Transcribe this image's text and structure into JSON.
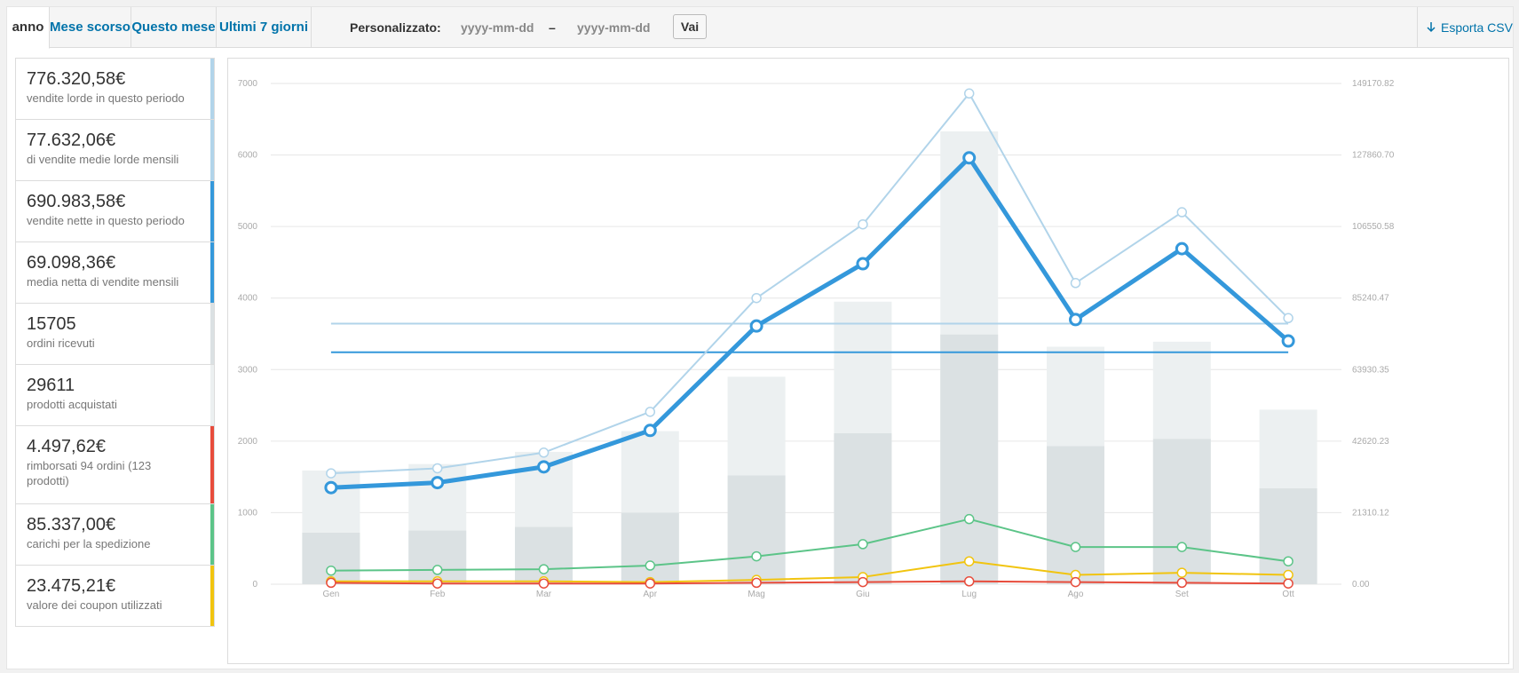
{
  "tabs": [
    {
      "label": "anno",
      "active": true
    },
    {
      "label": "Mese scorso"
    },
    {
      "label": "Questo mese"
    },
    {
      "label": "Ultimi 7 giorni"
    }
  ],
  "custom": {
    "label": "Personalizzato:",
    "start_placeholder": "yyyy-mm-dd",
    "separator": "–",
    "end_placeholder": "yyyy-mm-dd",
    "go_label": "Vai"
  },
  "export": {
    "icon": "arrow-down-icon",
    "label": "Esporta CSV"
  },
  "legend": [
    {
      "value": "776.320,58€",
      "desc": "vendite lorde in questo periodo",
      "color": "#b1d4ea"
    },
    {
      "value": "77.632,06€",
      "desc": "di vendite medie lorde mensili",
      "color": "#b1d4ea"
    },
    {
      "value": "690.983,58€",
      "desc": "vendite nette in questo periodo",
      "color": "#3498db"
    },
    {
      "value": "69.098,36€",
      "desc": "media netta di vendite mensili",
      "color": "#3498db"
    },
    {
      "value": "15705",
      "desc": "ordini ricevuti",
      "color": "#dbe1e3"
    },
    {
      "value": "29611",
      "desc": "prodotti acquistati",
      "color": "#ecf0f1"
    },
    {
      "value": "4.497,62€",
      "desc": "rimborsati 94 ordini (123 prodotti)",
      "color": "#e74c3c"
    },
    {
      "value": "85.337,00€",
      "desc": "carichi per la spedizione",
      "color": "#5cc488"
    },
    {
      "value": "23.475,21€",
      "desc": "valore dei coupon utilizzati",
      "color": "#f1c40f"
    }
  ],
  "chart_data": {
    "type": "bar",
    "categories": [
      "Gen",
      "Feb",
      "Mar",
      "Apr",
      "Mag",
      "Giu",
      "Lug",
      "Ago",
      "Set",
      "Ott"
    ],
    "left_axis": {
      "ylim": [
        0,
        7000
      ],
      "ticks": [
        "0",
        "1000",
        "2000",
        "3000",
        "4000",
        "5000",
        "6000",
        "7000"
      ]
    },
    "right_axis": {
      "ylim": [
        0,
        149170.82
      ],
      "ticks": [
        "0.00",
        "21310.12",
        "42620.23",
        "63930.35",
        "85240.47",
        "106550.58",
        "127860.70",
        "149170.82"
      ]
    },
    "grid": true,
    "series": [
      {
        "name": "prodotti acquistati",
        "kind": "bar",
        "axis": "left",
        "color": "#ecf0f1",
        "values": [
          1590,
          1680,
          1850,
          2140,
          2900,
          3950,
          6330,
          3320,
          3390,
          2440
        ]
      },
      {
        "name": "ordini ricevuti",
        "kind": "bar",
        "axis": "left",
        "color": "#dbe1e3",
        "values": [
          720,
          750,
          800,
          1000,
          1520,
          2110,
          3490,
          1930,
          2030,
          1340
        ]
      },
      {
        "name": "vendite lorde in questo periodo",
        "kind": "line",
        "axis": "left",
        "color": "#b1d4ea",
        "width": 2,
        "values": [
          1550,
          1620,
          1840,
          2410,
          4000,
          5030,
          6860,
          4210,
          5200,
          3720
        ]
      },
      {
        "name": "vendite nette in questo periodo",
        "kind": "line",
        "axis": "left",
        "color": "#3498db",
        "width": 5,
        "values": [
          1350,
          1420,
          1640,
          2150,
          3610,
          4480,
          5960,
          3700,
          4690,
          3400
        ]
      },
      {
        "name": "carichi per la spedizione",
        "kind": "line",
        "axis": "left",
        "color": "#5cc488",
        "width": 2,
        "values": [
          190,
          200,
          210,
          260,
          390,
          560,
          910,
          520,
          520,
          320
        ]
      },
      {
        "name": "valore dei coupon utilizzati",
        "kind": "line",
        "axis": "left",
        "color": "#f1c40f",
        "width": 2,
        "values": [
          40,
          40,
          40,
          30,
          60,
          100,
          320,
          130,
          160,
          130
        ]
      },
      {
        "name": "rimborsati",
        "kind": "line",
        "axis": "left",
        "color": "#e74c3c",
        "width": 2,
        "values": [
          20,
          10,
          10,
          10,
          20,
          30,
          40,
          30,
          20,
          10
        ]
      }
    ],
    "averages": [
      {
        "name": "di vendite medie lorde mensili",
        "value": 77632.06,
        "axis": "right",
        "color": "#b1d4ea"
      },
      {
        "name": "media netta di vendite mensili",
        "value": 69098.36,
        "axis": "right",
        "color": "#3498db"
      }
    ]
  }
}
